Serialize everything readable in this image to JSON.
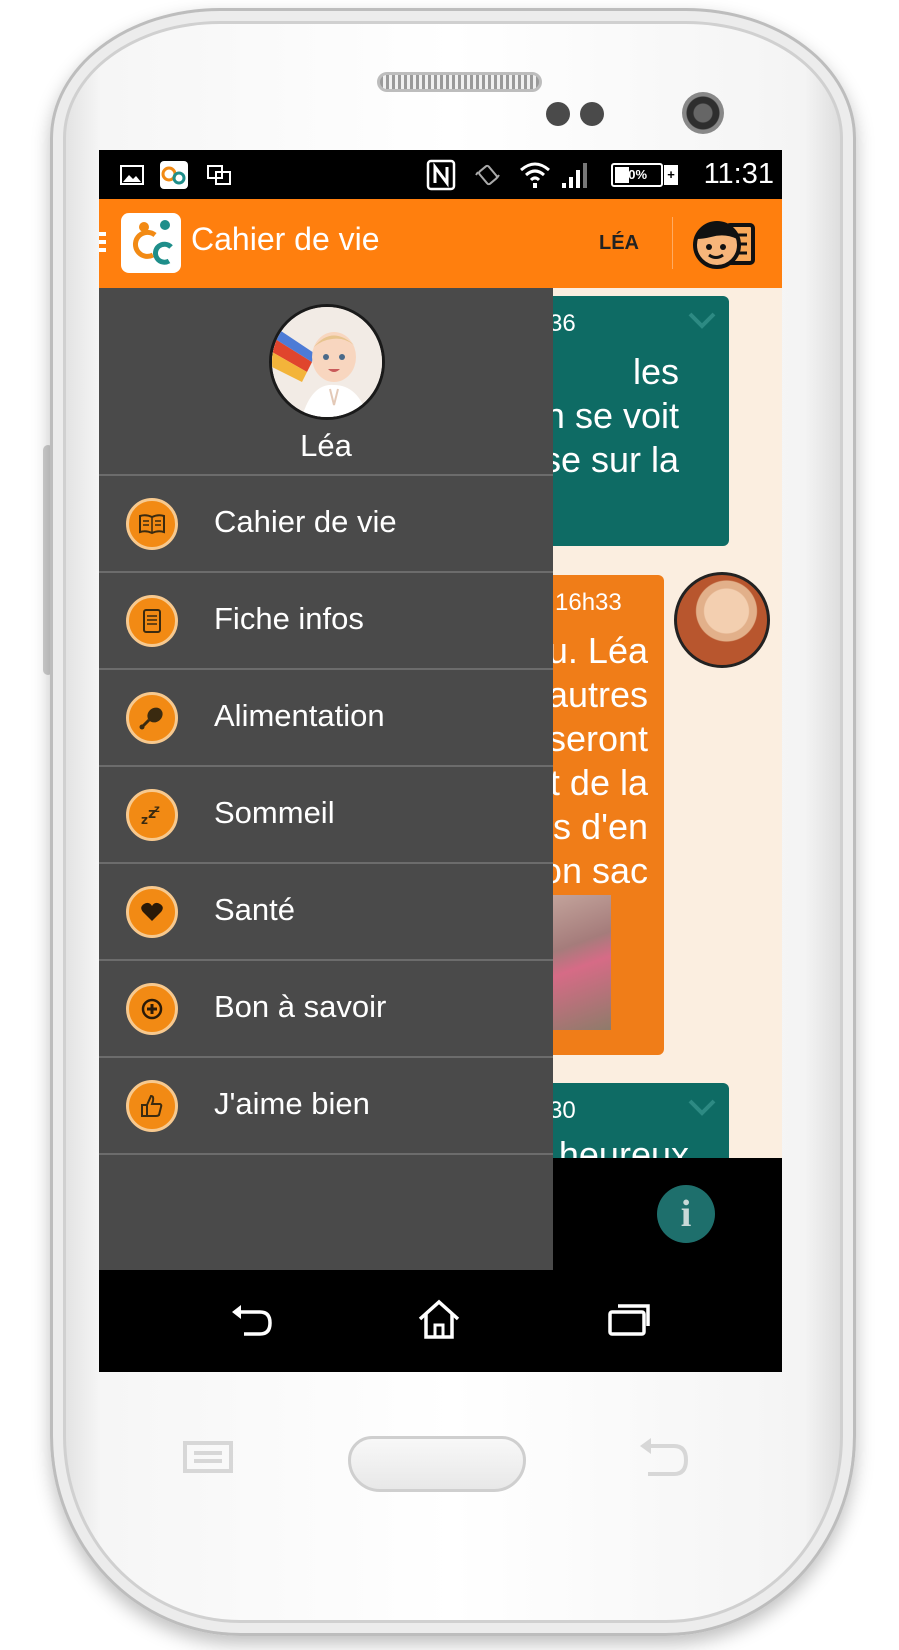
{
  "status_bar": {
    "time": "11:31",
    "battery_percent": "30%",
    "icons": [
      "picture-icon",
      "app-notification-icon",
      "screen-mirror-icon",
      "nfc-icon",
      "vibrate-icon",
      "wifi-icon",
      "signal-icon",
      "battery-charging-icon"
    ]
  },
  "action_bar": {
    "app_title": "Cahier de vie",
    "current_child": "LÉA",
    "accent_color": "#ff7f0e"
  },
  "drawer": {
    "profile_name": "Léa",
    "items": [
      {
        "label": "Cahier de vie",
        "icon": "book-icon"
      },
      {
        "label": "Fiche infos",
        "icon": "notepad-icon"
      },
      {
        "label": "Alimentation",
        "icon": "drumstick-icon"
      },
      {
        "label": "Sommeil",
        "icon": "zzz-icon"
      },
      {
        "label": "Santé",
        "icon": "heart-icon"
      },
      {
        "label": "Bon à savoir",
        "icon": "plus-circle-icon"
      },
      {
        "label": "J'aime bien",
        "icon": "thumbs-up-icon"
      }
    ]
  },
  "feed": {
    "bubble1": {
      "time": "36",
      "text": "les\nn se voit\nse sur la"
    },
    "bubble2": {
      "time": "à 16h33",
      "text": "u. Léa\nautres\nseront\nt de la\ns d'en\non sac"
    },
    "bubble3": {
      "time": "30",
      "text": "heureux"
    }
  }
}
